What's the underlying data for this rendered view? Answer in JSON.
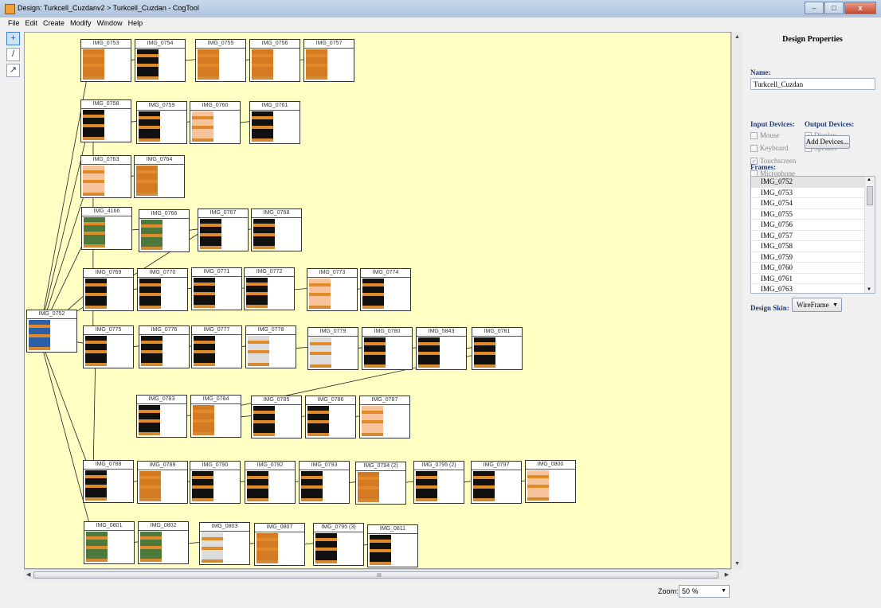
{
  "window": {
    "title": "Design: Turkcell_Cuzdanv2 > Turkcell_Cuzdan - CogTool",
    "close_label": "x"
  },
  "menu": [
    "File",
    "Edit",
    "Create",
    "Modify",
    "Window",
    "Help"
  ],
  "tools": [
    {
      "icon": "select-tool-icon",
      "glyph": "+"
    },
    {
      "icon": "pencil-tool-icon",
      "glyph": "/"
    },
    {
      "icon": "transition-tool-icon",
      "glyph": "↗"
    }
  ],
  "canvas": {
    "background": "#ffffc4",
    "frames": [
      {
        "label": "IMG_0753",
        "style": "orange"
      },
      {
        "label": "IMG_0754",
        "style": "dark"
      },
      {
        "label": "IMG_0755",
        "style": "orange"
      },
      {
        "label": "IMG_0756",
        "style": "orange"
      },
      {
        "label": "IMG_0757",
        "style": "orange"
      },
      {
        "label": "IMG_0758",
        "style": "dark"
      },
      {
        "label": "IMG_0759",
        "style": "dark"
      },
      {
        "label": "IMG_0760",
        "style": "peach"
      },
      {
        "label": "IMG_0761",
        "style": "dark"
      },
      {
        "label": "IMG_0763",
        "style": "peach"
      },
      {
        "label": "IMG_0764",
        "style": "orange"
      },
      {
        "label": "IMG_4166",
        "style": "green"
      },
      {
        "label": "IMG_0766",
        "style": "green"
      },
      {
        "label": "IMG_0767",
        "style": "dark"
      },
      {
        "label": "IMG_0768",
        "style": "dark"
      },
      {
        "label": "IMG_0769",
        "style": "dark"
      },
      {
        "label": "IMG_0770",
        "style": "dark"
      },
      {
        "label": "IMG_0771",
        "style": "dark"
      },
      {
        "label": "IMG_0772",
        "style": "dark"
      },
      {
        "label": "IMG_0773",
        "style": "peach"
      },
      {
        "label": "IMG_0774",
        "style": "dark"
      },
      {
        "label": "IMG_0752",
        "style": "blue"
      },
      {
        "label": "IMG_0775",
        "style": "dark"
      },
      {
        "label": "IMG_0776",
        "style": "dark"
      },
      {
        "label": "IMG_0777",
        "style": "dark"
      },
      {
        "label": "IMG_0778",
        "style": "light"
      },
      {
        "label": "IMG_0779",
        "style": "light"
      },
      {
        "label": "IMG_0780",
        "style": "dark"
      },
      {
        "label": "IMG_5843",
        "style": "dark"
      },
      {
        "label": "IMG_0781",
        "style": "dark"
      },
      {
        "label": "IMG_0783",
        "style": "dark"
      },
      {
        "label": "IMG_0784",
        "style": "orange"
      },
      {
        "label": "IMG_0785",
        "style": "dark"
      },
      {
        "label": "IMG_0786",
        "style": "dark"
      },
      {
        "label": "IMG_0787",
        "style": "peach"
      },
      {
        "label": "IMG_0788",
        "style": "dark"
      },
      {
        "label": "IMG_0789",
        "style": "orange"
      },
      {
        "label": "IMG_0790",
        "style": "dark"
      },
      {
        "label": "IMG_0792",
        "style": "dark"
      },
      {
        "label": "IMG_0793",
        "style": "dark"
      },
      {
        "label": "IMG_0794 (2)",
        "style": "orange"
      },
      {
        "label": "IMG_0795 (2)",
        "style": "dark"
      },
      {
        "label": "IMG_0797",
        "style": "dark"
      },
      {
        "label": "IMG_0800",
        "style": "peach"
      },
      {
        "label": "IMG_0801",
        "style": "green"
      },
      {
        "label": "IMG_0802",
        "style": "green"
      },
      {
        "label": "IMG_0803",
        "style": "light"
      },
      {
        "label": "IMG_0807",
        "style": "orange"
      },
      {
        "label": "IMG_0795 (3)",
        "style": "dark"
      },
      {
        "label": "IMG_0811",
        "style": "dark"
      }
    ]
  },
  "hscroll": {
    "grip": "III"
  },
  "zoom": {
    "label": "Zoom:",
    "value": "50 %"
  },
  "properties": {
    "title": "Design Properties",
    "name_label": "Name:",
    "name_value": "Turkcell_Cuzdan",
    "input_devices_label": "Input Devices:",
    "output_devices_label": "Output Devices:",
    "input_devices": [
      {
        "label": "Mouse",
        "checked": false
      },
      {
        "label": "Keyboard",
        "checked": false
      },
      {
        "label": "Touchscreen",
        "checked": true
      },
      {
        "label": "Microphone",
        "checked": false
      }
    ],
    "output_devices": [
      {
        "label": "Display",
        "checked": true
      },
      {
        "label": "Speaker",
        "checked": false
      }
    ],
    "add_devices_label": "Add Devices...",
    "frames_label": "Frames:",
    "frames": [
      "IMG_0752",
      "IMG_0753",
      "IMG_0754",
      "IMG_0755",
      "IMG_0756",
      "IMG_0757",
      "IMG_0758",
      "IMG_0759",
      "IMG_0760",
      "IMG_0761",
      "IMG_0763"
    ],
    "skin_label": "Design Skin:",
    "skin_value": "WireFrame"
  }
}
